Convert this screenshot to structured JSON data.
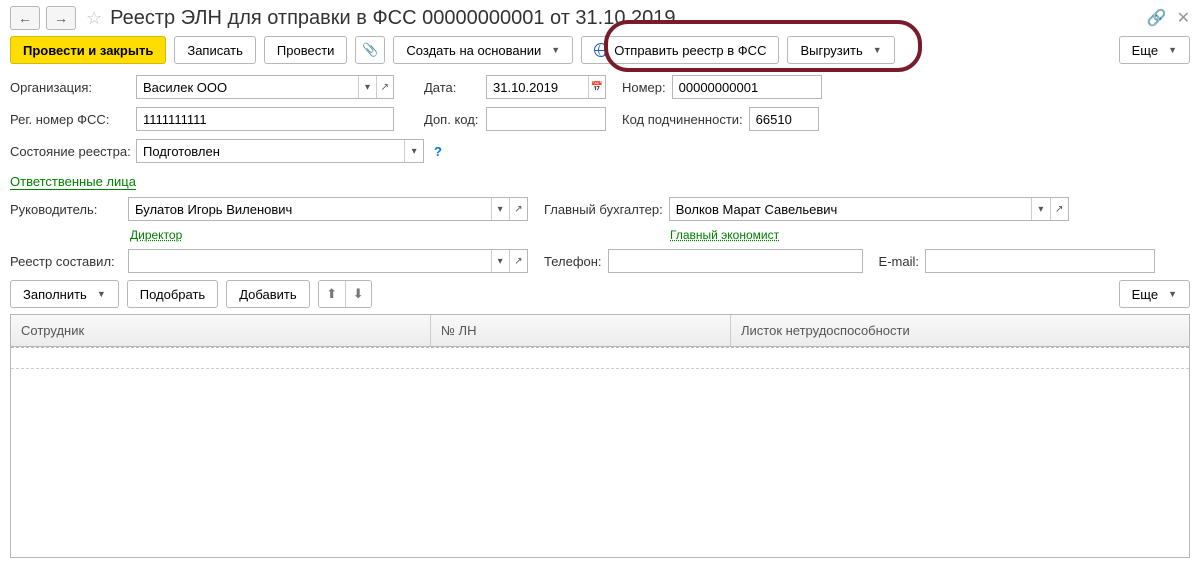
{
  "title": "Реестр ЭЛН для отправки в ФСС 00000000001 от 31.10.2019",
  "toolbar": {
    "post_and_close": "Провести и закрыть",
    "save": "Записать",
    "post": "Провести",
    "create_based_on": "Создать на основании",
    "send_to_fss": "Отправить реестр в ФСС",
    "export": "Выгрузить",
    "more": "Еще"
  },
  "labels": {
    "organization": "Организация:",
    "date": "Дата:",
    "number": "Номер:",
    "fss_reg_number": "Рег. номер ФСС:",
    "extra_code": "Доп. код:",
    "subordination_code": "Код подчиненности:",
    "registry_state": "Состояние реестра:",
    "responsible_persons": "Ответственные лица",
    "head": "Руководитель:",
    "chief_accountant": "Главный бухгалтер:",
    "registry_compiled_by": "Реестр составил:",
    "phone": "Телефон:",
    "email": "E-mail:"
  },
  "values": {
    "organization": "Василек ООО",
    "date": "31.10.2019",
    "number": "00000000001",
    "fss_reg_number": "1111111111",
    "extra_code": "",
    "subordination_code": "66510",
    "registry_state": "Подготовлен",
    "head": "Булатов Игорь Виленович",
    "head_position": "Директор",
    "chief_accountant": "Волков Марат Савельевич",
    "chief_accountant_position": "Главный экономист",
    "registry_compiled_by": "",
    "phone": "",
    "email": ""
  },
  "table_toolbar": {
    "fill": "Заполнить",
    "pick": "Подобрать",
    "add": "Добавить",
    "more": "Еще"
  },
  "table": {
    "columns": [
      "Сотрудник",
      "№ ЛН",
      "Листок нетрудоспособности"
    ],
    "rows": []
  }
}
